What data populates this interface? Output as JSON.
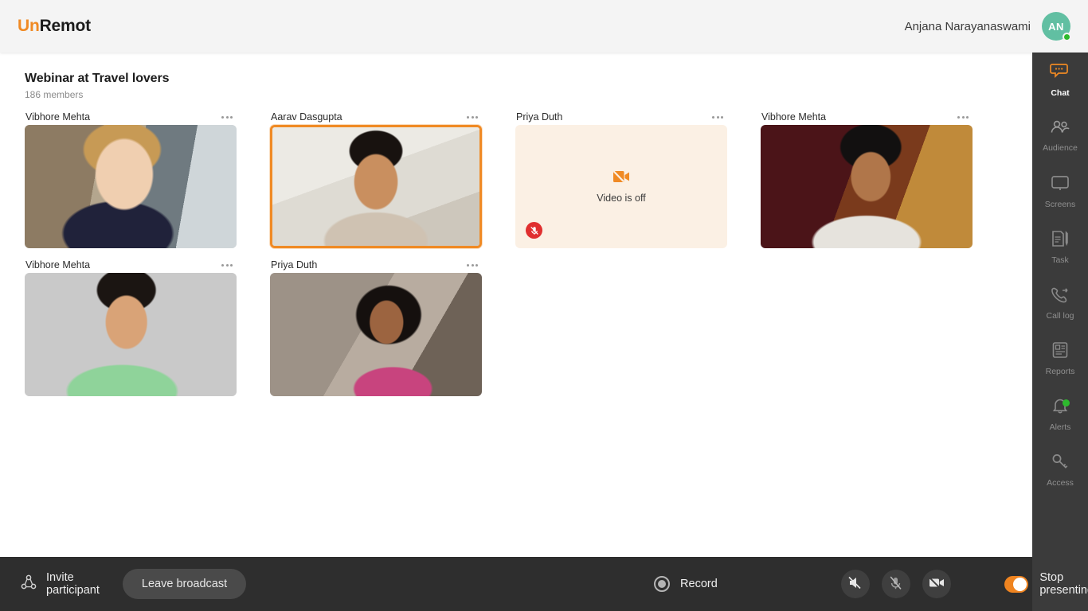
{
  "header": {
    "logo_prefix": "Un",
    "logo_suffix": "Remot",
    "user_name": "Anjana Narayanaswami",
    "avatar_initials": "AN",
    "status": "online",
    "brand_color": "#f08a24",
    "avatar_color": "#61bfa2",
    "status_color": "#2db92d"
  },
  "main": {
    "meeting_title": "Webinar at Travel lovers",
    "members_count": "186 members",
    "video_off_text": "Video is off",
    "active_border_color": "#f08a24",
    "video_off_bg": "#fbf0e4",
    "mute_badge_color": "#e02f2f",
    "tiles": [
      {
        "name": "Vibhore Mehta",
        "state": "video-on",
        "active": false,
        "muted": false
      },
      {
        "name": "Aarav Dasgupta",
        "state": "video-on",
        "active": true,
        "muted": false
      },
      {
        "name": "Priya Duth",
        "state": "video-off",
        "active": false,
        "muted": true
      },
      {
        "name": "Vibhore Mehta",
        "state": "video-on",
        "active": false,
        "muted": false
      },
      {
        "name": "Vibhore Mehta",
        "state": "video-on",
        "active": false,
        "muted": false
      },
      {
        "name": "Priya Duth",
        "state": "video-on",
        "active": false,
        "muted": false
      }
    ]
  },
  "sidebar": {
    "active_accent": "#f08a24",
    "items": [
      {
        "label": "Chat",
        "icon": "chat-icon",
        "active": true,
        "badge": false
      },
      {
        "label": "Audience",
        "icon": "audience-icon",
        "active": false,
        "badge": false
      },
      {
        "label": "Screens",
        "icon": "screens-icon",
        "active": false,
        "badge": false
      },
      {
        "label": "Task",
        "icon": "task-icon",
        "active": false,
        "badge": false
      },
      {
        "label": "Call log",
        "icon": "call-log-icon",
        "active": false,
        "badge": false
      },
      {
        "label": "Reports",
        "icon": "reports-icon",
        "active": false,
        "badge": false
      },
      {
        "label": "Alerts",
        "icon": "alerts-icon",
        "active": false,
        "badge": true
      },
      {
        "label": "Access",
        "icon": "access-key-icon",
        "active": false,
        "badge": false
      }
    ]
  },
  "toolbar": {
    "invite_label": "Invite participant",
    "leave_label": "Leave broadcast",
    "record_label": "Record",
    "present_label": "Stop presenting",
    "present_toggle_on": true,
    "toggle_color": "#ef8420",
    "media_buttons": [
      {
        "icon": "speaker-off-icon",
        "state": "off"
      },
      {
        "icon": "mic-off-icon",
        "state": "off"
      },
      {
        "icon": "video-off-icon",
        "state": "off"
      }
    ]
  }
}
